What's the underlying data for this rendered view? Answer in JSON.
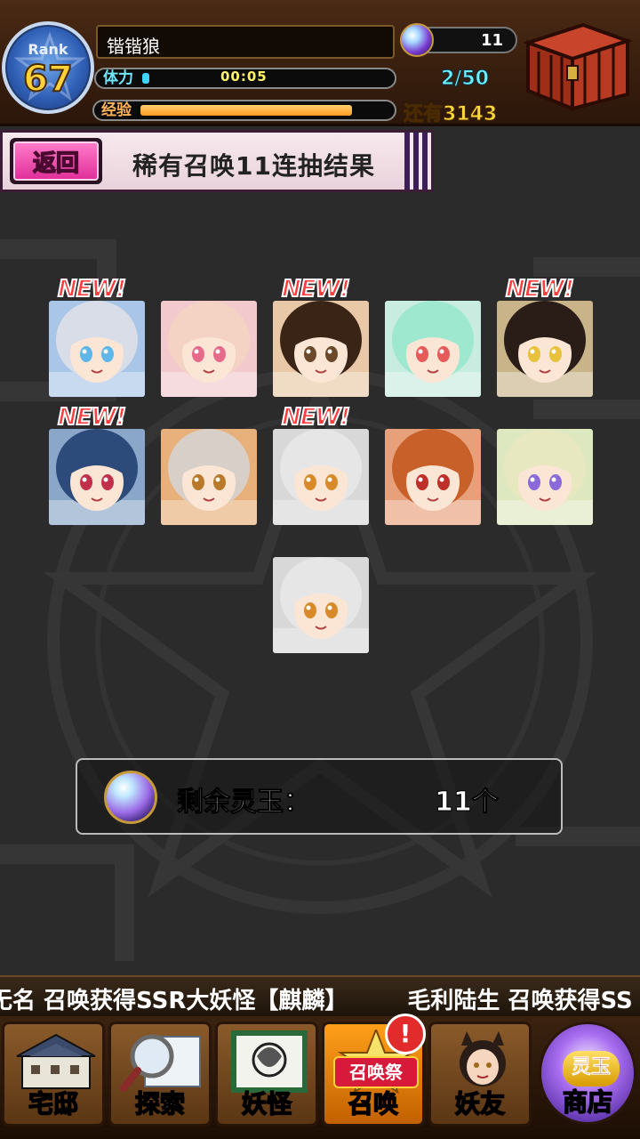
{
  "header": {
    "rank_label": "Rank",
    "rank_value": "67",
    "player_name": "锴锴狼",
    "stamina_label": "体力",
    "stamina_timer": "00:05",
    "stamina_count": "2/50",
    "stamina_fill_fraction": 0.02,
    "exp_label": "经验",
    "exp_fill_fraction": 0.85,
    "exp_remaining": "还有3143",
    "orb_count": "11"
  },
  "title_strip": {
    "back_label": "返回",
    "title": "稀有召唤11连抽结果"
  },
  "results": {
    "new_label": "NEW!",
    "cards": [
      {
        "new": true,
        "theme": "#a9c6e8",
        "hair": "#d9dde8",
        "eye": "#5fb6e8"
      },
      {
        "new": false,
        "theme": "#f2c9cc",
        "hair": "#f4d2c4",
        "eye": "#e86a8a"
      },
      {
        "new": true,
        "theme": "#e8c8a6",
        "hair": "#3a2416",
        "eye": "#6a4a2a"
      },
      {
        "new": false,
        "theme": "#c8ece0",
        "hair": "#9ee8cf",
        "eye": "#e65a5a"
      },
      {
        "new": true,
        "theme": "#c9b48a",
        "hair": "#2a1c16",
        "eye": "#e8c23a"
      },
      {
        "new": true,
        "theme": "#8aa6c8",
        "hair": "#2c4a7a",
        "eye": "#c0304a"
      },
      {
        "new": false,
        "theme": "#e8b07a",
        "hair": "#d8d0c8",
        "eye": "#b87a2a"
      },
      {
        "new": true,
        "theme": "#d8d8d8",
        "hair": "#e6e6e6",
        "eye": "#d88a2a"
      },
      {
        "new": false,
        "theme": "#e8a07a",
        "hair": "#c8602a",
        "eye": "#c0302a"
      },
      {
        "new": false,
        "theme": "#dde8c0",
        "hair": "#e8e8c0",
        "eye": "#8a6ad8"
      },
      {
        "new": false,
        "theme": "#d8d8d8",
        "hair": "#e6e6e6",
        "eye": "#d88a2a"
      }
    ]
  },
  "remaining": {
    "label": "剩余灵玉：",
    "value": "11个"
  },
  "ticker": {
    "messages": [
      "无名 召唤获得SSR大妖怪【麒麟】",
      "毛利陆生 召唤获得SS"
    ]
  },
  "bottom_nav": {
    "items": [
      {
        "label": "宅邸",
        "icon": "mansion-icon"
      },
      {
        "label": "探索",
        "icon": "magnifier-map-icon"
      },
      {
        "label": "妖怪",
        "icon": "scroll-icon"
      },
      {
        "label": "召唤",
        "icon": "summon-star-icon",
        "fest_label": "召唤祭",
        "badge": "!"
      },
      {
        "label": "妖友",
        "icon": "friend-portrait-icon"
      },
      {
        "label": "商店",
        "icon": "spirit-orb-icon",
        "orb_label": "灵玉"
      }
    ]
  },
  "colors": {
    "background": "#2a2a2a",
    "accent_pink": "#e0309a",
    "stamina": "#3fd3ff",
    "exp": "#ff9a22",
    "new_badge": "#ff3b3b"
  }
}
